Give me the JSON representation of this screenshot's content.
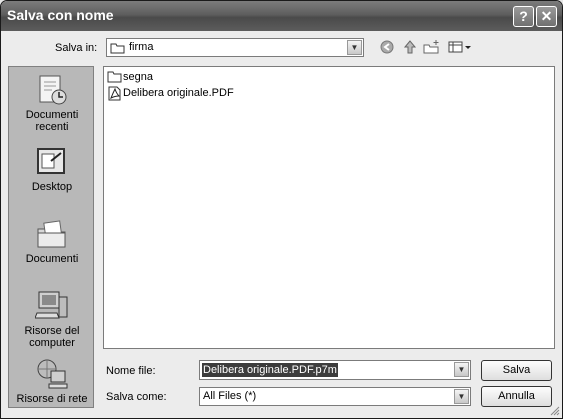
{
  "window": {
    "title": "Salva con nome",
    "help_glyph": "?",
    "close_glyph": "✕"
  },
  "location": {
    "label": "Salva in:",
    "value": "firma"
  },
  "toolbar": {
    "back_icon": "back-icon",
    "up_icon": "up-folder-icon",
    "new_folder_icon": "new-folder-icon",
    "views_icon": "views-menu-icon"
  },
  "places": [
    {
      "label": "Documenti recenti",
      "icon": "recent-documents-icon"
    },
    {
      "label": "Desktop",
      "icon": "desktop-icon"
    },
    {
      "label": "Documenti",
      "icon": "documents-icon"
    },
    {
      "label": "Risorse del computer",
      "icon": "computer-icon"
    },
    {
      "label": "Risorse di rete",
      "icon": "network-icon"
    }
  ],
  "files": [
    {
      "name": "segna",
      "type": "folder"
    },
    {
      "name": "Delibera originale.PDF",
      "type": "pdf"
    }
  ],
  "filename": {
    "label": "Nome file:",
    "value": "Delibera originale.PDF.p7m"
  },
  "filetype": {
    "label": "Salva come:",
    "value": "All Files (*)"
  },
  "buttons": {
    "save": "Salva",
    "cancel": "Annulla"
  }
}
